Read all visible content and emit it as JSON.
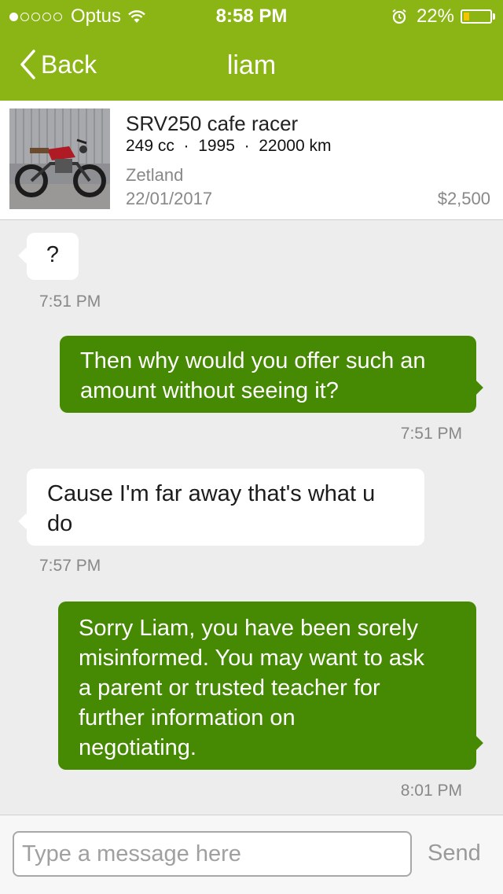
{
  "status_bar": {
    "carrier": "Optus",
    "time": "8:58 PM",
    "battery": "22%",
    "battery_level": 0.22,
    "signal_bars": 1,
    "signal_total": 5,
    "icons": [
      "wifi-icon",
      "alarm-icon",
      "battery-icon"
    ]
  },
  "nav": {
    "back_label": "Back",
    "title": "liam",
    "bar_color": "#8bb514"
  },
  "listing": {
    "title": "SRV250 cafe racer",
    "specs": "249 cc  ·  1995  ·  22000 km",
    "location": "Zetland",
    "date": "22/01/2017",
    "price": "$2,500",
    "image_icon": "motorcycle-photo"
  },
  "messages": [
    {
      "direction": "in",
      "lines": [
        "?"
      ],
      "time": "7:51 PM"
    },
    {
      "direction": "out",
      "lines": [
        "Then why would you offer such an",
        "amount without seeing it?"
      ],
      "time": "7:51 PM"
    },
    {
      "direction": "in",
      "lines": [
        "Cause I'm far away that's what u",
        "do"
      ],
      "time": "7:57 PM"
    },
    {
      "direction": "out",
      "lines": [
        "Sorry Liam, you have been sorely",
        "misinformed. You may want to ask",
        "a parent or trusted teacher for",
        "further information on",
        "negotiating."
      ],
      "time": "8:01 PM"
    }
  ],
  "colors": {
    "outgoing_bubble": "#468a03",
    "incoming_bubble": "#ffffff",
    "background": "#ededed"
  },
  "composer": {
    "placeholder": "Type a message here",
    "value": "",
    "send_label": "Send"
  }
}
